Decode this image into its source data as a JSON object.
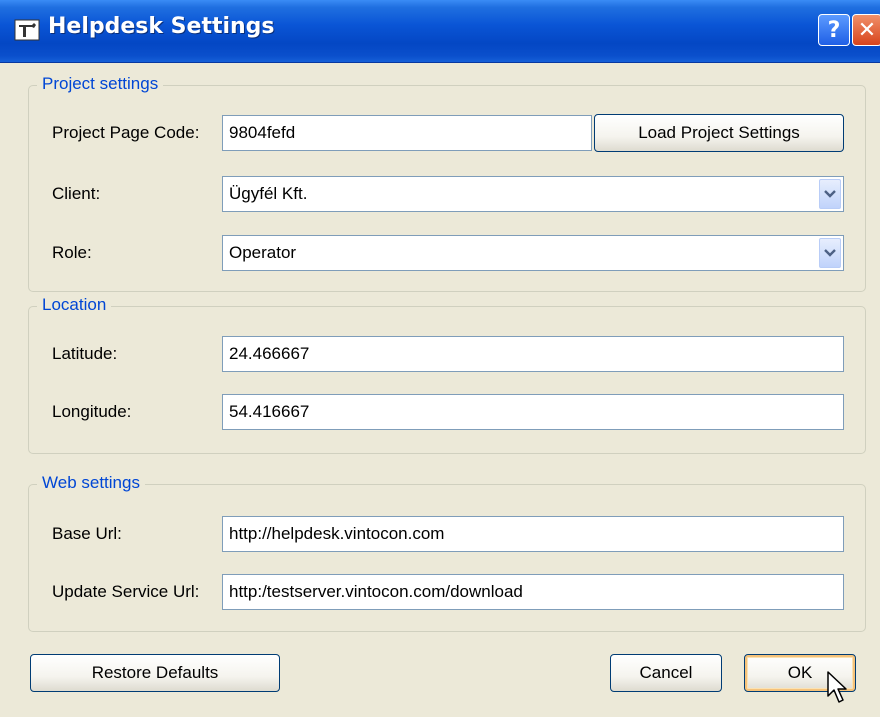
{
  "window": {
    "title": "Helpdesk Settings",
    "help_label": "?",
    "close_label": "✕"
  },
  "project": {
    "legend": "Project settings",
    "page_code_label": "Project Page Code:",
    "page_code_value": "9804fefd",
    "load_button": "Load Project Settings",
    "client_label": "Client:",
    "client_value": "Ügyfél Kft.",
    "role_label": "Role:",
    "role_value": "Operator"
  },
  "location": {
    "legend": "Location",
    "latitude_label": "Latitude:",
    "latitude_value": "24.466667",
    "longitude_label": "Longitude:",
    "longitude_value": "54.416667"
  },
  "web": {
    "legend": "Web settings",
    "base_url_label": "Base Url:",
    "base_url_value": "http://helpdesk.vintocon.com",
    "update_url_label": "Update Service Url:",
    "update_url_value": "http:/testserver.vintocon.com/download"
  },
  "buttons": {
    "restore": "Restore Defaults",
    "cancel": "Cancel",
    "ok": "OK"
  },
  "colors": {
    "titlebar": "#0a55d6",
    "group_legend": "#0046d5",
    "dialog_bg": "#ece9d8"
  },
  "icons": {
    "app": "hammer-icon",
    "combo": "chevron-down-icon",
    "cursor": "mouse-pointer-icon"
  }
}
